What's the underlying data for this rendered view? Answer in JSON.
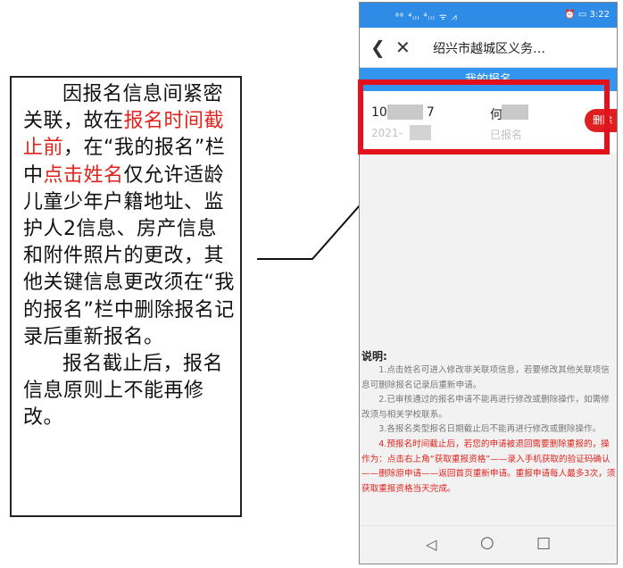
{
  "annotation": {
    "p1_pre": "因报名信息间紧密关联，故在",
    "p1_red1": "报名时间截止前",
    "p1_mid": "，在“我的报名”栏中",
    "p1_red2": "点击姓名",
    "p1_post": "仅允许适龄儿童少年户籍地址、监护人2信息、房产信息和附件照片的更改，其他关键信息更改须在“我的报名”栏中删除报名记录后重新报名。",
    "p2": "报名截止后，报名信息原则上不能再修改。"
  },
  "phone": {
    "status": {
      "left": "⁸⁸ ⁴ᵢₗₗ ⁴ᵢₗₗ ᯤ ⩘",
      "right": "⏰ ▭ 3:22"
    },
    "title": "绍兴市越城区义务…",
    "section_header": "我的报名",
    "record": {
      "id": "10",
      "id_tail": "7",
      "date": "2021-",
      "name": "何",
      "status": "已报名",
      "delete_label": "删除"
    },
    "notes": {
      "heading": "说明:",
      "items": [
        "1.点击姓名可进入修改非关联项信息，若要修改其他关联项信息可删除报名记录后重新申请。",
        "2.已审核通过的报名申请不能再进行修改或删除操作，如需修改须与相关学校联系。",
        "3.各报名类型报名日期截止后不能再进行修改或删除操作。",
        "4.预报名时间截止后，若您的申请被退回需要删除重报的，操作为：点击右上角“获取重报资格”——录入手机获取的验证码确认——删除原申请——返回首页重新申请。重报申请每人最多3次，须获取重报资格当天完成。"
      ]
    },
    "nav": {
      "back": "◁",
      "home": "○",
      "recent": "□"
    }
  },
  "colors": {
    "accent_blue": "#3296f0",
    "highlight_red": "#e3111c"
  }
}
